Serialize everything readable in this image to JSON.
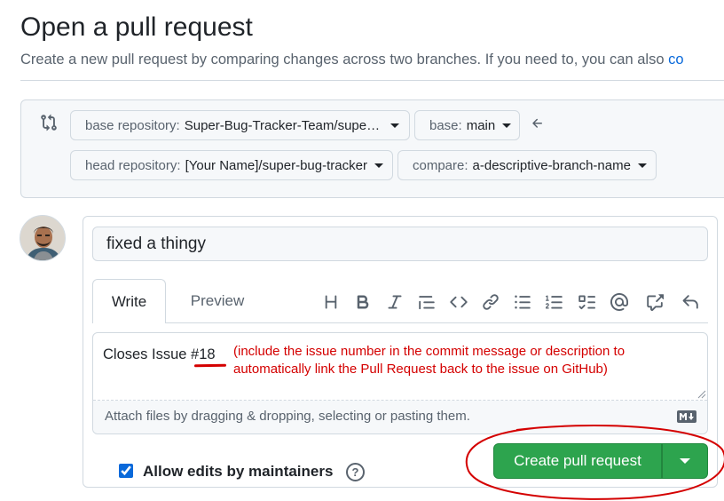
{
  "header": {
    "title": "Open a pull request",
    "subtitle": "Create a new pull request by comparing changes across two branches. If you need to, you can also ",
    "subtitle_link": "co"
  },
  "range": {
    "base_repository": {
      "label": "base repository:",
      "value": "Super-Bug-Tracker-Team/supe…"
    },
    "base": {
      "label": "base:",
      "value": "main"
    },
    "head_repository": {
      "label": "head repository:",
      "value": "[Your Name]/super-bug-tracker"
    },
    "compare": {
      "label": "compare:",
      "value": "a-descriptive-branch-name"
    },
    "swap_icon": "arrow-left-icon"
  },
  "form": {
    "title_value": "fixed a thingy",
    "tabs": [
      {
        "label": "Write"
      },
      {
        "label": "Preview"
      }
    ],
    "toolbar_icons": [
      "heading",
      "bold",
      "italic",
      "quote",
      "code",
      "link",
      "unordered-list",
      "ordered-list",
      "task-list",
      "mention",
      "cross-reference",
      "undo"
    ],
    "body_text": "Closes Issue #18",
    "attach_text": "Attach files by dragging & dropping, selecting or pasting them.",
    "markdown_badge": "M↓",
    "allow_edits_label": "Allow edits by maintainers",
    "allow_edits_checked": true,
    "help_glyph": "?",
    "create_button": "Create pull request"
  },
  "annotation": {
    "line1": "(include the issue number in the commit message or description to",
    "line2": "automatically link the Pull Request back to the issue on GitHub)",
    "color": "#d40000"
  },
  "colors": {
    "primary_button": "#2da44e",
    "link": "#0969da"
  }
}
